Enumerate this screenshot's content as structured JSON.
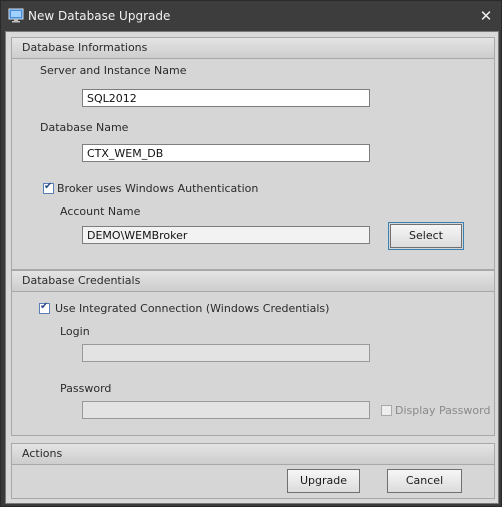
{
  "window": {
    "title": "New Database Upgrade",
    "close_glyph": "✕"
  },
  "db_info": {
    "header": "Database Informations",
    "server_label": "Server and Instance Name",
    "server_value": "SQL2012",
    "dbname_label": "Database Name",
    "dbname_value": "CTX_WEM_DB",
    "broker_auth_label": "Broker uses Windows Authentication",
    "broker_auth_checked": true,
    "account_label": "Account Name",
    "account_value": "DEMO\\WEMBroker",
    "select_label": "Select"
  },
  "credentials": {
    "header": "Database Credentials",
    "integrated_label": "Use Integrated Connection (Windows Credentials)",
    "integrated_checked": true,
    "login_label": "Login",
    "login_value": "",
    "password_label": "Password",
    "password_value": "",
    "display_password_label": "Display Password",
    "display_password_checked": false
  },
  "actions": {
    "header": "Actions",
    "upgrade_label": "Upgrade",
    "cancel_label": "Cancel"
  },
  "colors": {
    "titlebar": "#3d3d3d",
    "client": "#d9d9d9",
    "focus": "#3c7fb1"
  },
  "icons": {
    "app": "database-window-icon",
    "close": "close-icon"
  }
}
